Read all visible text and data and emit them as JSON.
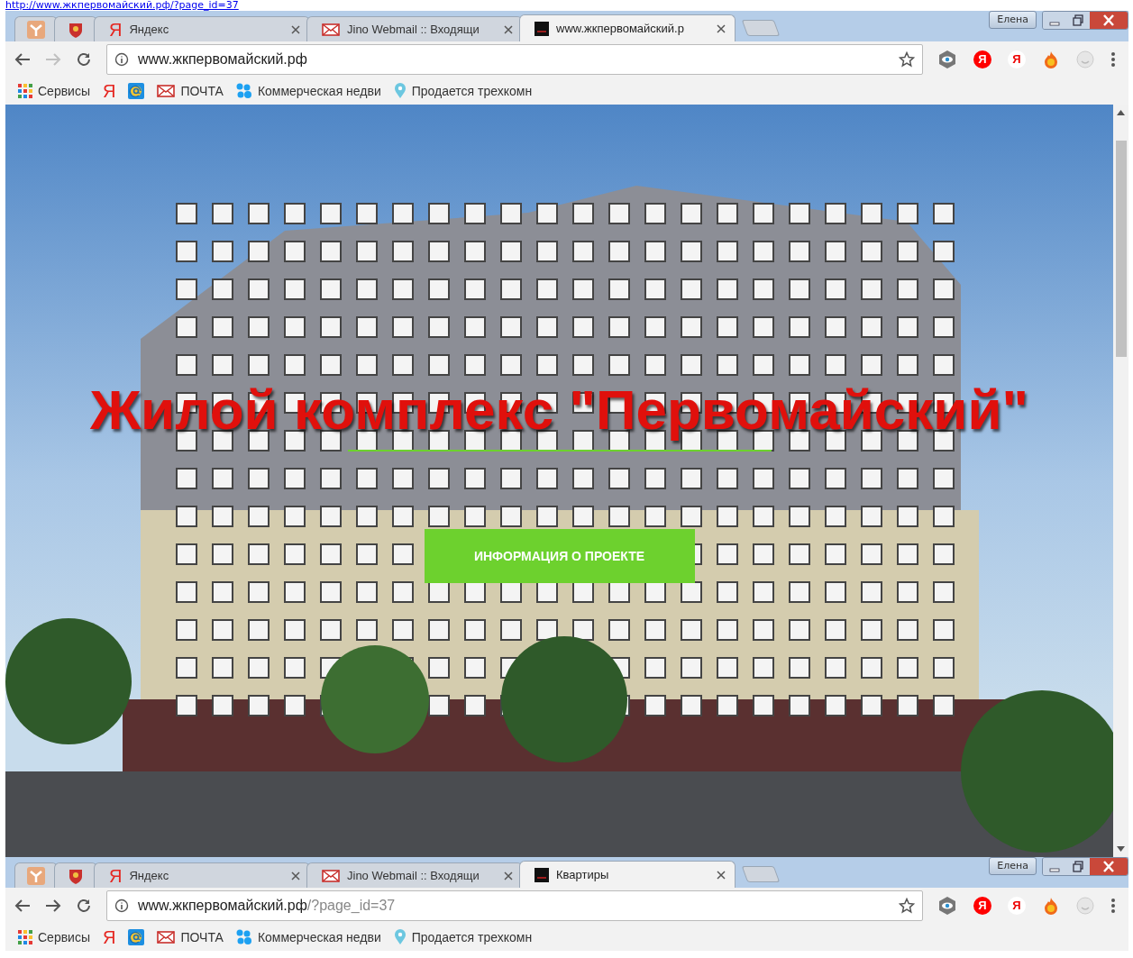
{
  "top_link": "http://www.жкпервомайский.рф/?page_id=37",
  "windows": [
    {
      "tabs": [
        {
          "selected": false
        },
        {
          "selected": false
        },
        {
          "icon_text": "Я",
          "title": "Яндекс",
          "selected": false
        },
        {
          "title": "Jino Webmail :: Входящи",
          "selected": false
        },
        {
          "title": "www.жкпервомайский.р",
          "selected": true
        }
      ],
      "profile": "Елена",
      "forward_enabled": false,
      "address": {
        "host": "www.жкпервомайский.рф"
      },
      "extensions": [
        {
          "text": "Я"
        },
        {
          "text": "Я"
        }
      ],
      "bookmarks": [
        {
          "kind": "labeled",
          "label": "Сервисы"
        },
        {
          "kind": "letter",
          "icon_text": "Я"
        },
        {
          "kind": "icon"
        },
        {
          "kind": "labeled",
          "label": "ПОЧТА"
        },
        {
          "kind": "labeled",
          "label": "Коммерческая недви"
        },
        {
          "kind": "labeled",
          "label": "Продается трехкомн"
        }
      ],
      "page": {
        "title": "Жилой комплекс \"Первомайский\"",
        "button": "ИНФОРМАЦИЯ О ПРОЕКТЕ"
      }
    },
    {
      "tabs": [
        {
          "selected": false
        },
        {
          "selected": false
        },
        {
          "icon_text": "Я",
          "title": "Яндекс",
          "selected": false
        },
        {
          "title": "Jino Webmail :: Входящи",
          "selected": false
        },
        {
          "title": "Квартиры",
          "selected": true
        }
      ],
      "profile": "Елена",
      "forward_enabled": true,
      "address": {
        "host": "www.жкпервомайский.рф",
        "path": "/?page_id=37"
      },
      "extensions": [
        {
          "text": "Я"
        },
        {
          "text": "Я"
        }
      ],
      "bookmarks": [
        {
          "kind": "labeled",
          "label": "Сервисы"
        },
        {
          "kind": "letter",
          "icon_text": "Я"
        },
        {
          "kind": "icon"
        },
        {
          "kind": "labeled",
          "label": "ПОЧТА"
        },
        {
          "kind": "labeled",
          "label": "Коммерческая недви"
        },
        {
          "kind": "labeled",
          "label": "Продается трехкомн"
        }
      ]
    }
  ]
}
